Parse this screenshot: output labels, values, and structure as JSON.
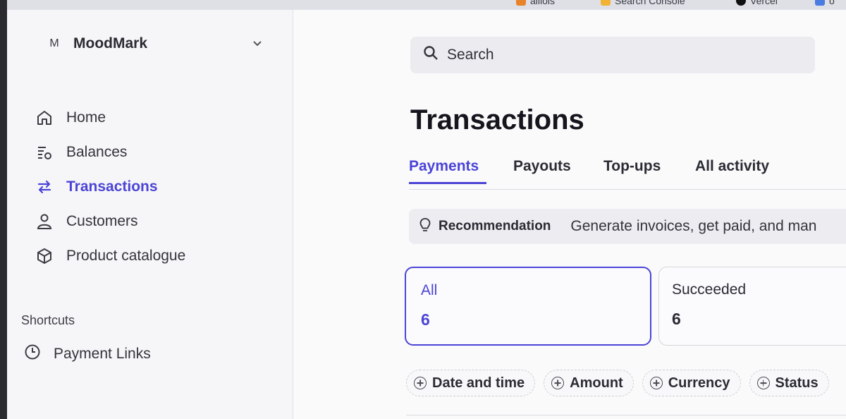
{
  "browser_bookmarks": [
    {
      "label": "alliols",
      "icon": "favicon-orange"
    },
    {
      "label": "Search Console",
      "icon": "search-console-icon"
    },
    {
      "label": "Vercel",
      "icon": "vercel-triangle-icon"
    },
    {
      "label": "o",
      "icon": "docs-icon"
    }
  ],
  "account": {
    "avatar": "M",
    "name": "MoodMark"
  },
  "sidebar": {
    "items": [
      {
        "label": "Home",
        "icon": "home-icon"
      },
      {
        "label": "Balances",
        "icon": "balances-icon"
      },
      {
        "label": "Transactions",
        "icon": "transactions-icon",
        "active": true
      },
      {
        "label": "Customers",
        "icon": "user-icon"
      },
      {
        "label": "Product catalogue",
        "icon": "cube-icon"
      }
    ],
    "shortcuts_title": "Shortcuts",
    "shortcuts": [
      {
        "label": "Payment Links",
        "icon": "clock-icon"
      }
    ]
  },
  "search": {
    "placeholder": "Search"
  },
  "page": {
    "title": "Transactions"
  },
  "tabs": [
    {
      "label": "Payments",
      "active": true
    },
    {
      "label": "Payouts"
    },
    {
      "label": "Top-ups"
    },
    {
      "label": "All activity"
    }
  ],
  "recommendation": {
    "label": "Recommendation",
    "text": "Generate invoices, get paid, and man"
  },
  "status_cards": [
    {
      "label": "All",
      "count": "6",
      "selected": true
    },
    {
      "label": "Succeeded",
      "count": "6"
    }
  ],
  "filters": [
    "Date and time",
    "Amount",
    "Currency",
    "Status"
  ],
  "colors": {
    "accent": "#4b44d6",
    "text": "#1a1b25",
    "sidebar_bg": "#f6f6f8"
  }
}
